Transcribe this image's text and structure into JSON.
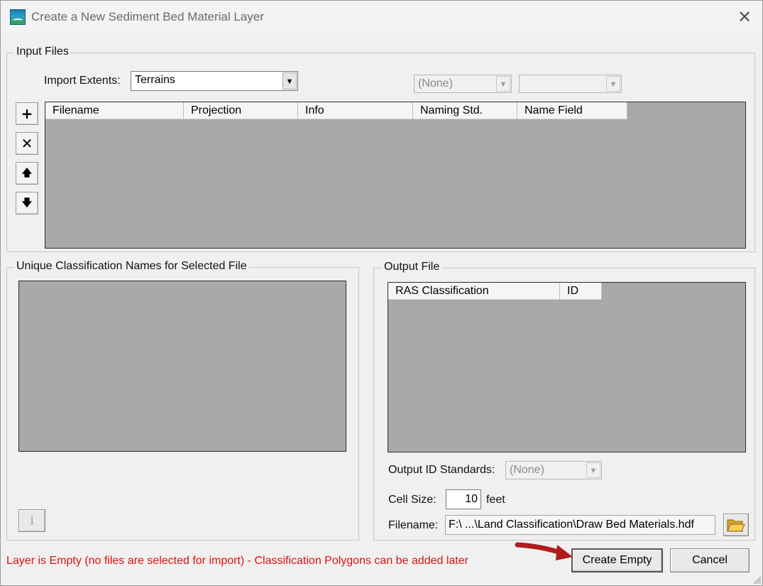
{
  "window": {
    "title": "Create a New Sediment Bed Material Layer",
    "close_glyph": "✕"
  },
  "input_files": {
    "group_label": "Input Files",
    "import_extents_label": "Import Extents:",
    "import_extents_value": "Terrains",
    "naming_combo_value": "(None)",
    "name_field_combo_value": "",
    "columns": [
      "Filename",
      "Projection",
      "Info",
      "Naming Std.",
      "Name Field"
    ],
    "side_buttons": [
      {
        "name": "add-file-button",
        "glyph": "+"
      },
      {
        "name": "remove-file-button",
        "glyph": "✕"
      },
      {
        "name": "move-up-button",
        "glyph": "🡅"
      },
      {
        "name": "move-down-button",
        "glyph": "🡇"
      }
    ]
  },
  "unique_names": {
    "group_label": "Unique Classification Names for Selected File",
    "info_glyph": "i"
  },
  "output_file": {
    "group_label": "Output File",
    "columns": [
      "RAS Classification",
      "ID"
    ],
    "id_standards_label": "Output ID Standards:",
    "id_standards_value": "(None)",
    "cell_size_label": "Cell Size:",
    "cell_size_value": "10",
    "cell_size_units": "feet",
    "filename_label": "Filename:",
    "filename_value": "F:\\ ...\\Land Classification\\Draw Bed Materials.hdf"
  },
  "status_text": "Layer is Empty (no files are selected for import) - Classification Polygons can be added later",
  "buttons": {
    "create_empty": "Create Empty",
    "cancel": "Cancel"
  },
  "colors": {
    "status_text": "#e01010",
    "arrow_annotation": "#b01c1c",
    "grid_background": "#a9a9a9"
  }
}
